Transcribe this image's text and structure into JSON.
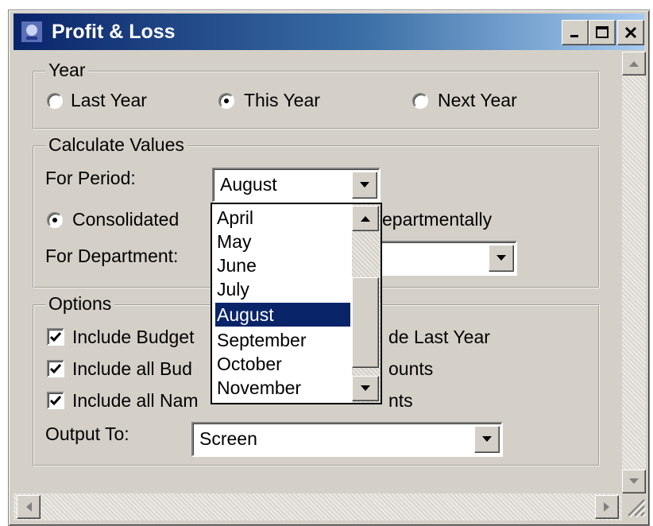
{
  "window": {
    "title": "Profit & Loss",
    "icon": "app-icon",
    "controls": [
      "minimize-icon",
      "maximize-icon",
      "close-icon"
    ]
  },
  "year_group": {
    "title": "Year",
    "options": [
      {
        "label": "Last Year",
        "selected": false
      },
      {
        "label": "This Year",
        "selected": true
      },
      {
        "label": "Next Year",
        "selected": false
      }
    ]
  },
  "calc_group": {
    "title": "Calculate Values",
    "period_label": "For Period:",
    "period_value": "August",
    "consolidated_label": "Consolidated",
    "departmentally_label": "epartmentally",
    "department_label": "For Department:",
    "department_value": ""
  },
  "period_dropdown": {
    "items": [
      "April",
      "May",
      "June",
      "July",
      "August",
      "September",
      "October",
      "November"
    ],
    "selected": "August"
  },
  "options_group": {
    "title": "Options",
    "checks": [
      {
        "label": "Include Budget",
        "checked": true
      },
      {
        "label": "Include all Bud",
        "checked": true
      },
      {
        "label": "Include all Nam",
        "checked": true
      }
    ],
    "right_labels": [
      "de Last Year",
      "ounts",
      "nts"
    ],
    "output_label": "Output To:",
    "output_value": "Screen"
  },
  "colors": {
    "title_gradient_start": "#0a246a",
    "title_gradient_end": "#a6caf0",
    "face": "#d4d0c8",
    "selection": "#0a246a"
  }
}
